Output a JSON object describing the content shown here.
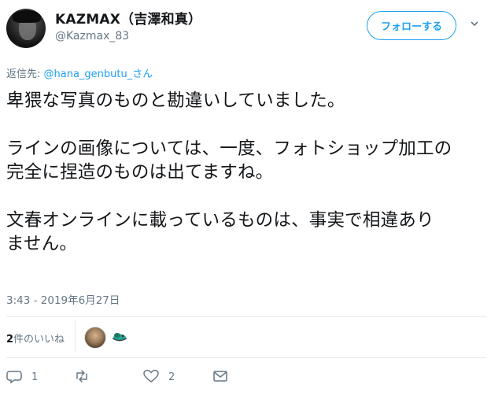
{
  "user": {
    "name": "KAZMAX（吉澤和真）",
    "handle": "@Kazmax_83",
    "follow_label": "フォローする"
  },
  "reply": {
    "prefix": "返信先: ",
    "mention": "@hana_genbutu",
    "suffix": "_さん"
  },
  "tweet": {
    "line1": "卑猥な写真のものと勘違いしていました。",
    "line2": "ラインの画像については、一度、フォトショップ加工の",
    "line3": "完全に捏造のものは出てますね。",
    "line4": "文春オンラインに載っているものは、事実で相違あり",
    "line5": "ません。"
  },
  "timestamp": "3:43 - 2019年6月27日",
  "stats": {
    "likes_number": "2",
    "likes_label": "件のいいね"
  },
  "actions": {
    "reply_count": "1",
    "like_count": "2"
  },
  "icons": {
    "reply": "reply-icon",
    "retweet": "retweet-icon",
    "like": "heart-icon",
    "message": "message-icon",
    "caret": "chevron-down-icon"
  },
  "colors": {
    "accent": "#1da1f2",
    "muted": "#657786",
    "text": "#14171a",
    "divider": "#e6ecf0"
  }
}
